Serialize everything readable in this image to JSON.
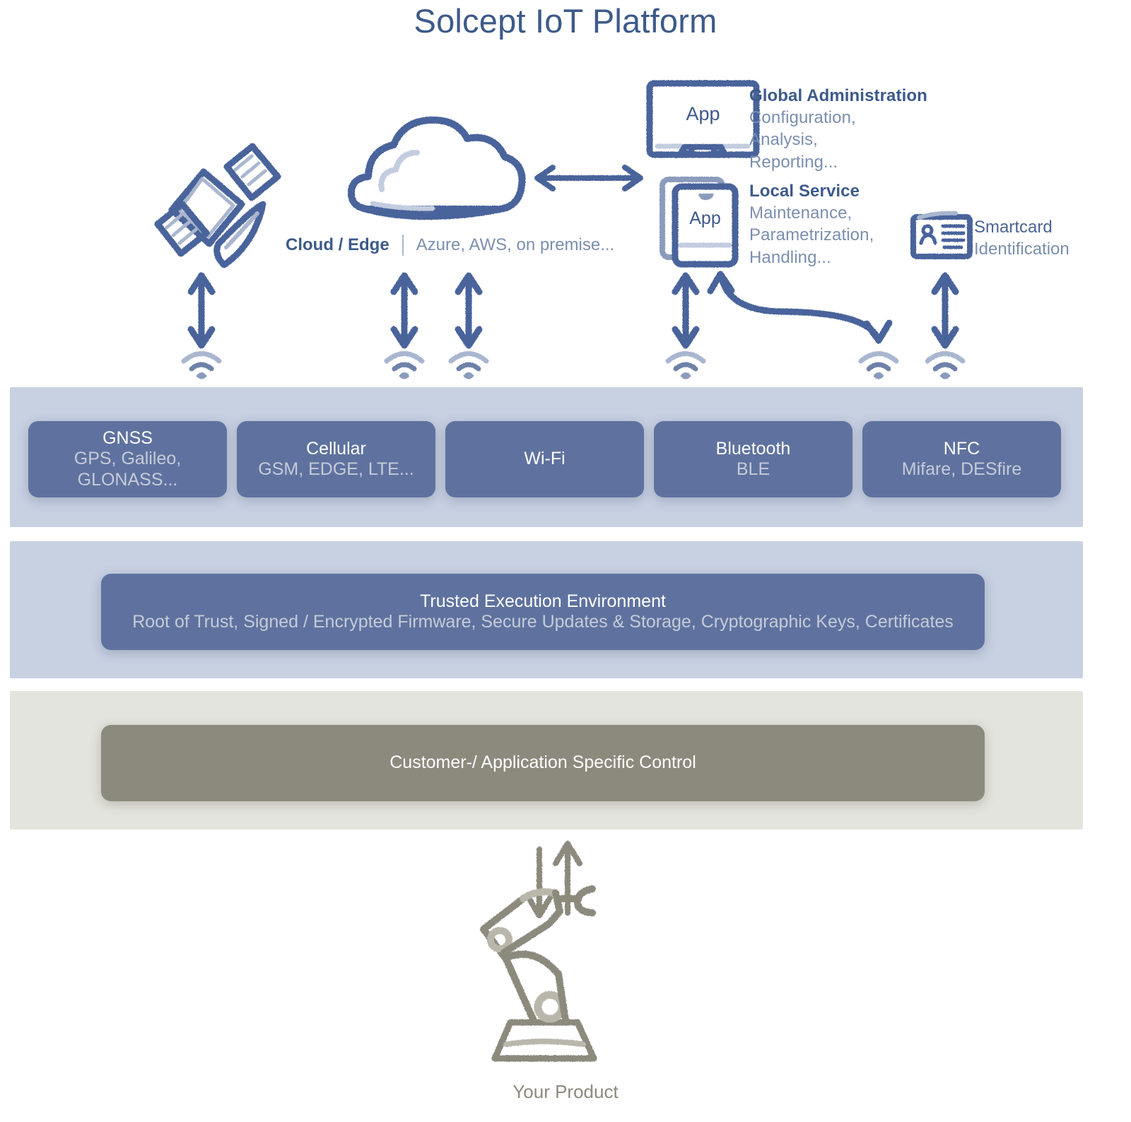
{
  "title": "Solcept IoT Platform",
  "top_annotations": [
    {
      "id": "global-administration",
      "heading": "Global Administration",
      "lines": [
        "Configuration,",
        "Analysis,",
        "Reporting..."
      ]
    },
    {
      "id": "local-service",
      "heading": "Local Service",
      "lines": [
        "Maintenance,",
        "Parametrization,",
        "Handling..."
      ]
    }
  ],
  "cloud_caption": {
    "bold": "Cloud / Edge",
    "light": "Azure, AWS, on premise..."
  },
  "smartcard_caption": {
    "line1": "Smartcard",
    "line2": "Identification"
  },
  "icons": {
    "satellite": "satellite-icon",
    "cloud": "cloud-icon",
    "monitor": "monitor-app-icon",
    "tablet": "tablet-app-icon",
    "smartcard": "smartcard-icon",
    "wifi_signal": "wifi-signal-icon",
    "people": "people-group-icon",
    "robot": "robot-arm-icon"
  },
  "app_labels": {
    "monitor": "App",
    "tablet": "App"
  },
  "connectivity": {
    "band_color": "#c8d1e2",
    "card_color": "#5f729f",
    "cards": [
      {
        "title": "GNSS",
        "subtitle": "GPS, Galileo, GLONASS..."
      },
      {
        "title": "Cellular",
        "subtitle": "GSM, EDGE, LTE..."
      },
      {
        "title": "Wi-Fi",
        "subtitle": ""
      },
      {
        "title": "Bluetooth",
        "subtitle": "BLE"
      },
      {
        "title": "NFC",
        "subtitle": "Mifare, DESfire"
      }
    ]
  },
  "security": {
    "band_color": "#c8d1e2",
    "card_color": "#5f729f",
    "title": "Trusted Execution Environment",
    "subtitle": "Root of Trust, Signed / Encrypted Firmware, Secure Updates & Storage, Cryptographic Keys, Certificates"
  },
  "control": {
    "band_color": "#e4e4de",
    "card_color": "#8c8a7d",
    "title": "Customer-/ Application Specific Control"
  },
  "product": {
    "caption": "Your Product"
  },
  "colors": {
    "title": "#3d5a8a",
    "heading": "#3d5a8a",
    "body_light": "#7b8fae",
    "ink_blue": "#4a649b",
    "ink_blue_light": "#a9b6cf",
    "ink_gray": "#8c8a7d",
    "ink_gray_light": "#b9b7ac"
  }
}
